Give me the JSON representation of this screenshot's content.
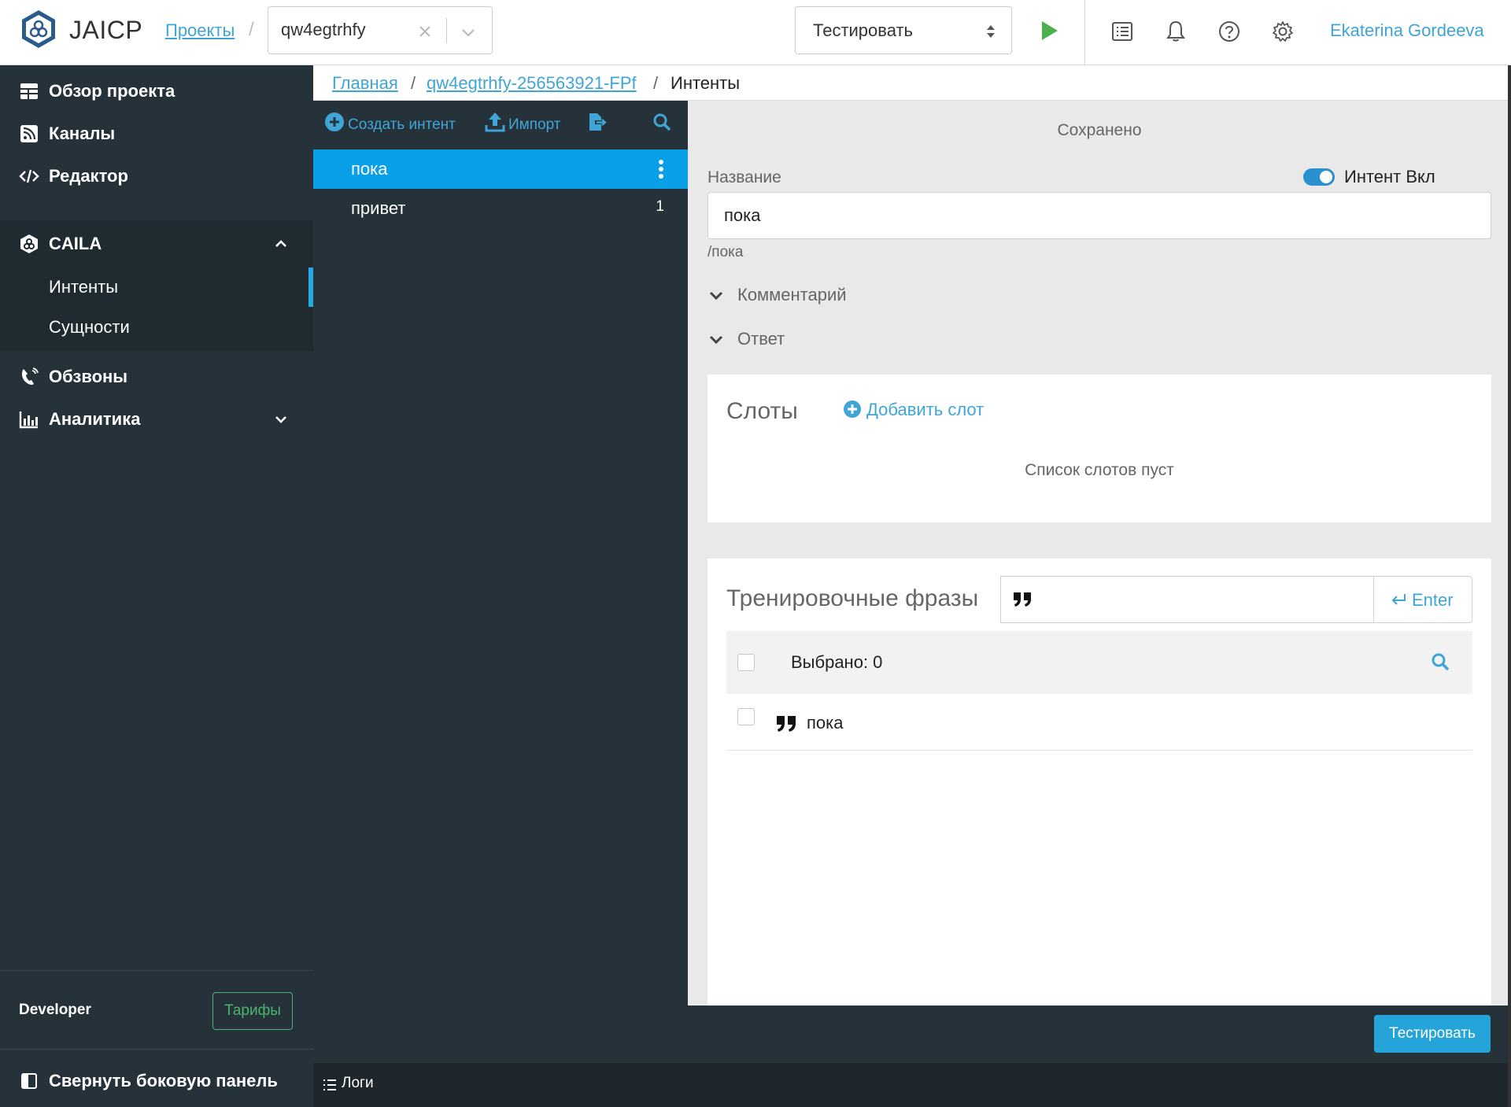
{
  "header": {
    "app_title": "JAICP",
    "projects_link": "Проекты",
    "separator": "/",
    "project_select": {
      "value": "qw4egtrhfy"
    },
    "test_select": {
      "value": "Тестировать"
    },
    "user_name": "Ekaterina Gordeeva",
    "icons": [
      "list-icon",
      "bell-icon",
      "help-icon",
      "gear-icon"
    ]
  },
  "sidebar": {
    "items": [
      {
        "label": "Обзор проекта",
        "icon": "grid-icon"
      },
      {
        "label": "Каналы",
        "icon": "rss-icon"
      },
      {
        "label": "Редактор",
        "icon": "code-icon"
      },
      {
        "label": "CAILA",
        "icon": "caila-icon",
        "expanded": true
      },
      {
        "label": "Обзвоны",
        "icon": "phone-icon"
      },
      {
        "label": "Аналитика",
        "icon": "chart-icon",
        "expanded": false
      }
    ],
    "caila_sub": [
      {
        "label": "Интенты",
        "active": true
      },
      {
        "label": "Сущности",
        "active": false
      }
    ],
    "plan_label": "Developer",
    "plan_button": "Тарифы",
    "collapse_label": "Свернуть боковую панель"
  },
  "breadcrumb": {
    "home": "Главная",
    "project": "qw4egtrhfy-256563921-FPf",
    "current": "Интенты",
    "separator": "/"
  },
  "intent_list": {
    "create_label": "Создать интент",
    "import_label": "Импорт",
    "items": [
      {
        "label": "пока",
        "active": true,
        "count": ""
      },
      {
        "label": "привет",
        "active": false,
        "count": "1"
      }
    ]
  },
  "editor": {
    "status": "Сохранено",
    "name_label": "Название",
    "toggle_label": "Интент Вкл",
    "toggle_on": true,
    "name_value": "пока",
    "path_hint": "/пока",
    "comment_label": "Комментарий",
    "answer_label": "Ответ",
    "slots": {
      "title": "Слоты",
      "add_label": "Добавить слот",
      "empty_text": "Список слотов пуст"
    },
    "phrases": {
      "title": "Тренировочные фразы",
      "input_value": "",
      "enter_label": "Enter",
      "selected_text": "Выбрано: 0",
      "items": [
        "пока"
      ]
    },
    "test_button": "Тестировать"
  },
  "logs": {
    "label": "Логи"
  },
  "colors": {
    "accent": "#3fa5d6",
    "sidebar_bg": "#26323a",
    "active_intent": "#0aa0e8",
    "plan_green": "#4cb36d",
    "play_green": "#4caf50"
  }
}
